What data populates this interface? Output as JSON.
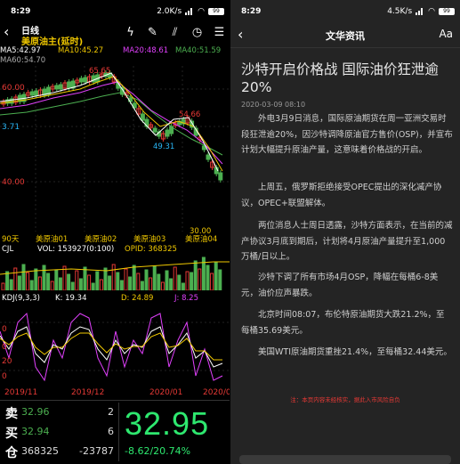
{
  "status_left": {
    "time": "8:29",
    "speed": "2.0K/s",
    "battery": "99"
  },
  "status_right": {
    "time": "8:29",
    "speed": "4.5K/s",
    "battery": "99"
  },
  "left_header": {
    "period": "日线",
    "instrument": "美原油主(延时)"
  },
  "ma_row1": {
    "ma5": "MA5:42.97",
    "ma10": "MA10:45.27",
    "ma20": "MA20:48.61",
    "ma40": "MA40:51.59"
  },
  "ma_row2": {
    "ma60": "MA60:54.70"
  },
  "price_axis": {
    "top": "60.00",
    "mid": "3.71",
    "bottom": "40.00"
  },
  "price_annotations": {
    "high": "65.65",
    "mid_high": "54.66",
    "low_mid": "49.31",
    "right_val": "30.00"
  },
  "contract_bar": {
    "left": "90天",
    "c1": "美原油01",
    "c2": "美原油02",
    "c3": "美原油03",
    "c4": "美原油04"
  },
  "volume_panel": {
    "label": "CJL",
    "vol": "VOL: 153927(0:100)",
    "opid": "OPID: 368325"
  },
  "kdj_panel": {
    "label": "KDJ(9,3,3)",
    "k": "K: 19.34",
    "d": "D: 24.89",
    "j": "J: 8.25"
  },
  "kdj_axis": {
    "a": "0",
    "b": "0",
    "c": "20",
    "d": "0"
  },
  "x_axis": {
    "t1": "2019/11",
    "t2": "2019/12",
    "t3": "2020/01",
    "t4": "2020/0"
  },
  "quote": {
    "sell_label": "卖",
    "sell_price": "32.96",
    "sell_qty": "2",
    "buy_label": "买",
    "buy_price": "32.94",
    "buy_qty": "6",
    "oi_label": "仓",
    "oi_value": "368325",
    "oi_change": "-23787",
    "last_price": "32.95",
    "change": "-8.62/20.74%"
  },
  "right_header": {
    "title": "文华资讯",
    "font_toggle": "Aa"
  },
  "article": {
    "title": "沙特开启价格战 国际油价狂泄逾20%",
    "date": "2020-03-09 08:10",
    "paragraphs": [
      "外电3月9日消息，国际原油期货在周一亚洲交易时段狂泄逾20%，因沙特调降原油官方售价(OSP)，并宣布计划大幅提升原油产量，这意味着价格战的开启。",
      "上周五，俄罗斯拒绝接受OPEC提出的深化减产协议，OPEC+联盟解体。",
      "两位消息人士周日透露，沙特方面表示，在当前的减产协议3月底到期后，计划将4月原油产量提升至1,000万桶/日以上。",
      "沙特下调了所有市场4月OSP，降幅在每桶6-8美元，油价应声暴跌。",
      "北京时间08:07，布伦特原油期货大跌21.2%，至每桶35.69美元。",
      "美国WTI原油期货重挫21.4%，至每桶32.44美元。"
    ],
    "disclaimer": "注：本页内容未经核实，据此入市风险自负"
  },
  "colors": {
    "up": "#e53935",
    "down": "#2ee86f",
    "ma5": "#ffffff",
    "ma10": "#f0c800",
    "ma20": "#e040fb",
    "ma40": "#4caf50"
  }
}
